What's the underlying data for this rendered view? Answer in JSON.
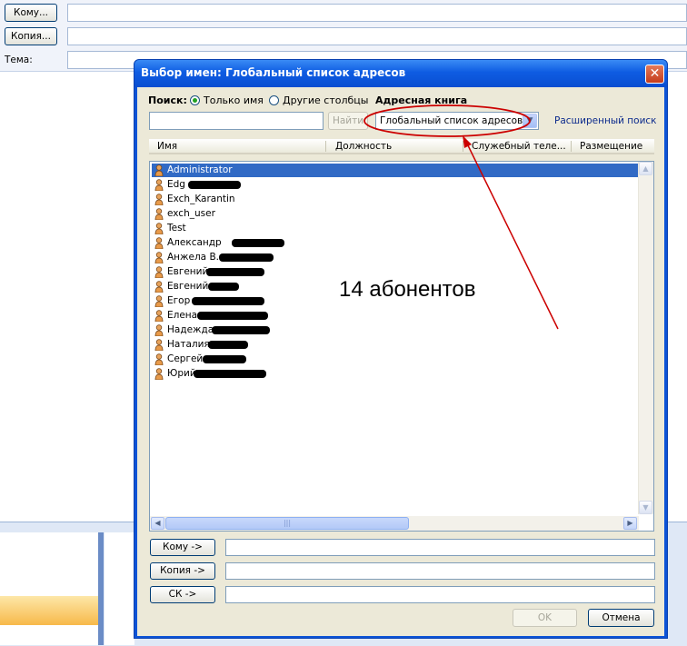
{
  "message_form": {
    "to_label": "Кому...",
    "cc_label": "Копия...",
    "subject_label": "Тема:"
  },
  "dialog": {
    "title": "Выбор имен: Глобальный список адресов",
    "close_glyph": "✕",
    "search_label": "Поиск:",
    "radio_name_only": "Только имя",
    "radio_other_columns": "Другие столбцы",
    "address_book_label": "Адресная книга",
    "find_button": "Найти",
    "address_book_value": "Глобальный список адресов",
    "advanced_search": "Расширенный поиск",
    "columns": [
      "Имя",
      "Должность",
      "Служебный теле...",
      "Размещение"
    ],
    "rows": [
      {
        "name": "Administrator",
        "selected": true
      },
      {
        "name": "Edg"
      },
      {
        "name": "Exch_Karantin"
      },
      {
        "name": "exch_user"
      },
      {
        "name": "Test"
      },
      {
        "name": "Александр"
      },
      {
        "name": "Анжела В."
      },
      {
        "name": "Евгений"
      },
      {
        "name": "Евгений"
      },
      {
        "name": "Егор"
      },
      {
        "name": "Елена"
      },
      {
        "name": "Надежда"
      },
      {
        "name": "Наталия"
      },
      {
        "name": "Сергей"
      },
      {
        "name": "Юрий"
      }
    ],
    "to_button": "Кому ->",
    "cc_button": "Копия ->",
    "bcc_button": "СК ->",
    "ok_button": "OK",
    "cancel_button": "Отмена"
  },
  "annotation": {
    "text": "14 абонентов",
    "color": "#cc0000"
  }
}
